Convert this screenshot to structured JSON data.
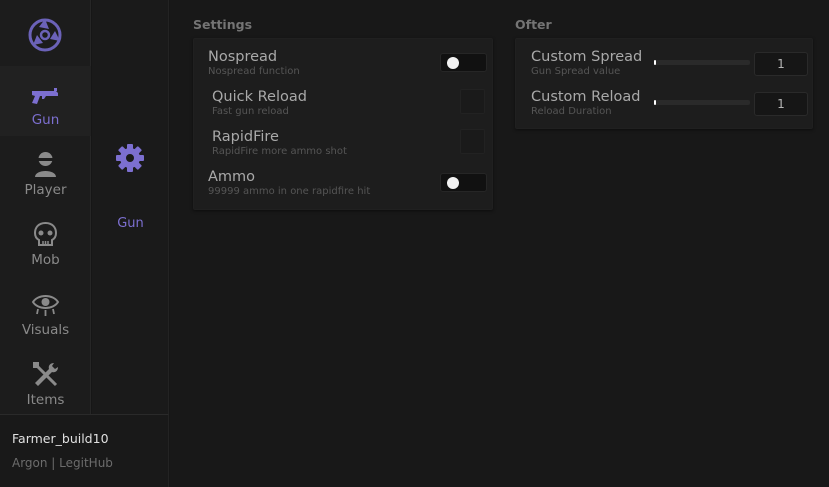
{
  "sidebar": {
    "items": [
      {
        "label": "Gun",
        "icon": "revolver-icon",
        "active": true
      },
      {
        "label": "Player",
        "icon": "person-icon",
        "active": false
      },
      {
        "label": "Mob",
        "icon": "skull-icon",
        "active": false
      },
      {
        "label": "Visuals",
        "icon": "eye-icon",
        "active": false
      },
      {
        "label": "Items",
        "icon": "tools-icon",
        "active": false
      }
    ]
  },
  "subnav": {
    "icon": "gear-icon",
    "item": "Gun"
  },
  "footer": {
    "user": "Farmer_build10",
    "subtitle": "Argon | LegitHub"
  },
  "settings": {
    "title": "Settings",
    "rows": [
      {
        "title": "Nospread",
        "desc": "Nospread function",
        "control": "toggle",
        "on": false
      },
      {
        "title": "Quick Reload",
        "desc": "Fast gun reload",
        "control": "checkbox",
        "checked": false
      },
      {
        "title": "RapidFire",
        "desc": "RapidFire more ammo shot",
        "control": "checkbox",
        "checked": false
      },
      {
        "title": "Ammo",
        "desc": "99999 ammo in one rapidfire hit",
        "control": "toggle",
        "on": false
      }
    ]
  },
  "ofter": {
    "title": "Ofter",
    "rows": [
      {
        "title": "Custom Spread",
        "desc": "Gun Spread value",
        "value": "1",
        "level": 0.02
      },
      {
        "title": "Custom Reload",
        "desc": "Reload Duration",
        "value": "1",
        "level": 0.02
      }
    ]
  },
  "colors": {
    "accent": "#7c6fd0",
    "background": "#161616",
    "panel": "#1d1d1d"
  }
}
